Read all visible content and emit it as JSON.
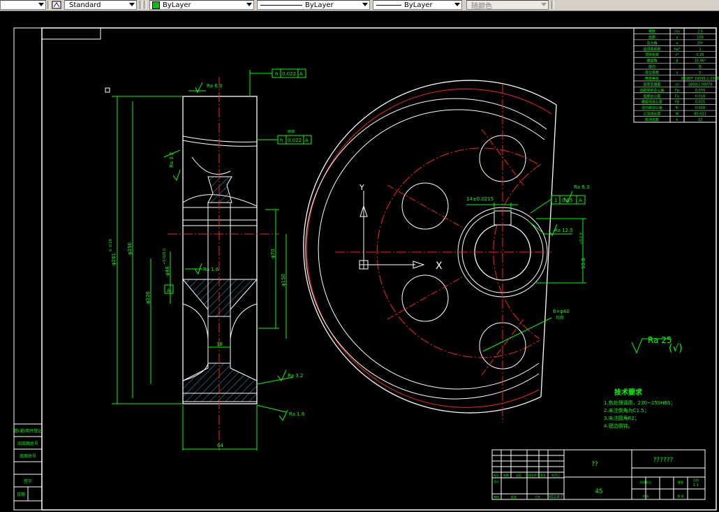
{
  "toolbar": {
    "text_style": "Standard",
    "layer": "ByLayer",
    "linetype": "ByLayer",
    "lineweight": "ByLayer",
    "plot_style": "随颜色"
  },
  "drawing": {
    "tech_req": {
      "title": "技术要求",
      "items": [
        "1.热处理调质，230~250HBS；",
        "2.未注倒角为C1.5；",
        "3.未注圆角R2；",
        "4.锐边倒钝。"
      ]
    },
    "gear_params": [
      [
        "模数",
        "mn",
        "2.5"
      ],
      [
        "齿数",
        "z",
        "100"
      ],
      [
        "压力角",
        "α",
        "20°"
      ],
      [
        "齿顶高系数",
        "ha*",
        "1"
      ],
      [
        "顶隙系数",
        "c*",
        "0.25"
      ],
      [
        "螺旋角",
        "β",
        "15.46°"
      ],
      [
        "旋向",
        "",
        "右"
      ],
      [
        "变位系数",
        "x",
        "0"
      ],
      [
        "精度等级",
        "",
        "8-GB/T 10095.1-2008"
      ],
      [
        "齿厚及偏差",
        "sn",
        "1803/2.00078"
      ],
      [
        "齿距累积总公差",
        "Fp",
        "0.070"
      ],
      [
        "齿廓总公差",
        "Fα",
        "0.018"
      ],
      [
        "螺旋线总公差",
        "Fβ",
        "0.025"
      ],
      [
        "径向跳动公差",
        "Fr",
        "0.028"
      ],
      [
        "公法线长度",
        "W",
        "80.631"
      ],
      [
        "跨测齿数",
        "k",
        "12"
      ]
    ],
    "title_block": {
      "part_name": "??",
      "drawing_title": "??????",
      "material": "45",
      "scale": "1:1",
      "date": "2011.8.7",
      "labels": [
        "标记",
        "处数",
        "分区",
        "更改文件号",
        "签名",
        "年月日",
        "设计",
        "审核",
        "工艺",
        "批准",
        "阶段标记",
        "重量",
        "比例",
        "共 张",
        "第 张"
      ]
    },
    "side_labels": [
      "借(通)用件登记",
      "旧底图总号",
      "底图总号",
      "签字",
      "日期"
    ],
    "side_view_labels": {
      "roughness_top": "Ra 6.3",
      "roughness_hub": "Ra 3.2",
      "roughness_bore": "Ra 1.6",
      "roughness_web": "Ra 3.2",
      "roughness_face": "Ra 1.6",
      "runout_top_tol": "0.022",
      "runout_top_sym": "h",
      "runout_top_datum": "A",
      "runout_mid_tol": "0.022",
      "runout_mid_sym": "h",
      "runout_mid_datum": "A",
      "runout_mid_note": "两端",
      "datum": "A",
      "dim_tip": "φ261",
      "dim_tip_tol": "0 -0.29",
      "dim_256": "φ256",
      "dim_hub_od": "φ226",
      "dim_bore": "φ48",
      "dim_bore_tol": "+0.025 0",
      "dim_70": "φ70",
      "dim_150": "φ150",
      "dim_width": "64",
      "dim_web": "18"
    },
    "front_view_labels": {
      "keyway_width": "14±0.0215",
      "roughness_key": "Ra 6.3",
      "roughness_key2": "Ra 12.5",
      "parallel_sym": "1",
      "parallel_tol": "0.05",
      "parallel_datum": "A",
      "key_depth": "53.8",
      "key_depth_tol": "+0.2 0",
      "holes": "6×φ40",
      "holes_note": "均布",
      "axis_x": "X",
      "axis_y": "Y",
      "general_roughness": "Ra 25",
      "general_roughness_other": "(√)"
    }
  }
}
